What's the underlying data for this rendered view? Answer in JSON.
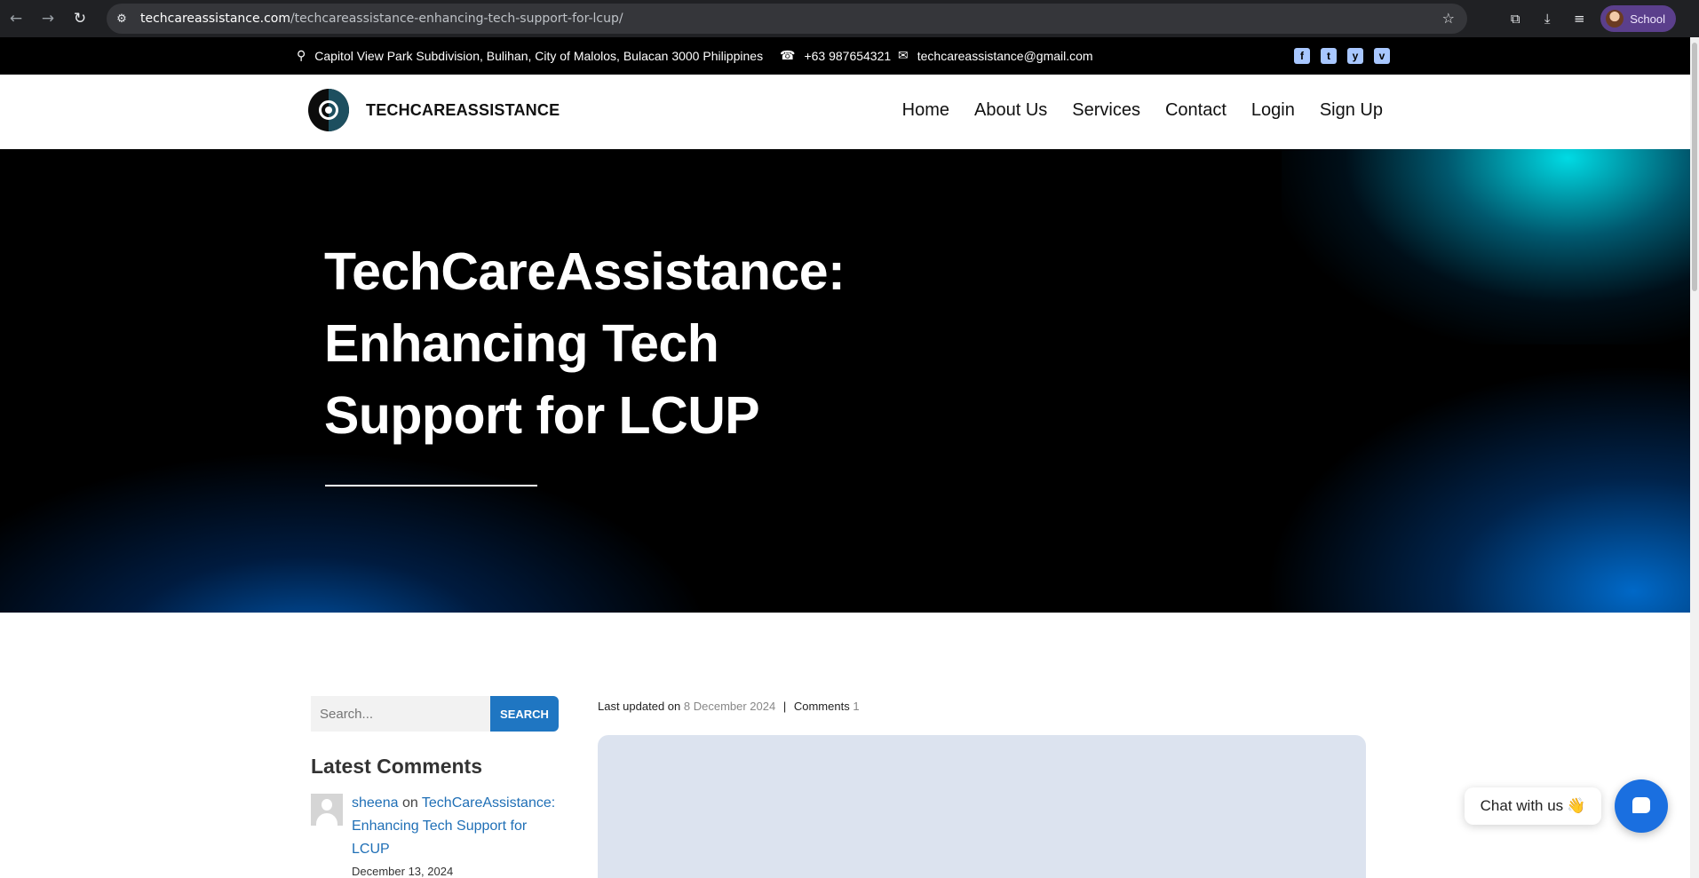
{
  "browser": {
    "url_host": "techcareassistance.com",
    "url_path": "/techcareassistance-enhancing-tech-support-for-lcup/",
    "profile_label": "School"
  },
  "topbar": {
    "address": "Capitol View Park Subdivision, Bulihan, City of Malolos, Bulacan 3000 Philippines",
    "phone": "+63 987654321",
    "email": "techcareassistance@gmail.com",
    "social": [
      "f",
      "t",
      "y",
      "v"
    ]
  },
  "header": {
    "logo_text": "TECHCAREASSISTANCE",
    "nav": [
      "Home",
      "About Us",
      "Services",
      "Contact",
      "Login",
      "Sign Up"
    ]
  },
  "hero": {
    "title_lines": [
      "TechCareAssistance:",
      "Enhancing Tech",
      "Support for LCUP"
    ]
  },
  "sidebar": {
    "search_placeholder": "Search...",
    "search_button": "SEARCH",
    "latest_comments_title": "Latest Comments",
    "comment": {
      "author": "sheena",
      "on": "on",
      "post_link": "TechCareAssistance: Enhancing Tech Support for LCUP",
      "date": "December 13, 2024"
    }
  },
  "post_meta": {
    "updated_label": "Last updated on",
    "updated_date": "8 December 2024",
    "comments_label": "Comments",
    "comments_count": "1"
  },
  "chat": {
    "label": "Chat with us",
    "emoji": "👋"
  },
  "colors": {
    "accent": "#1f76c2",
    "hero_bg": "#000000",
    "glow_cyan": "#00e6f0",
    "glow_blue": "#006ed2"
  }
}
